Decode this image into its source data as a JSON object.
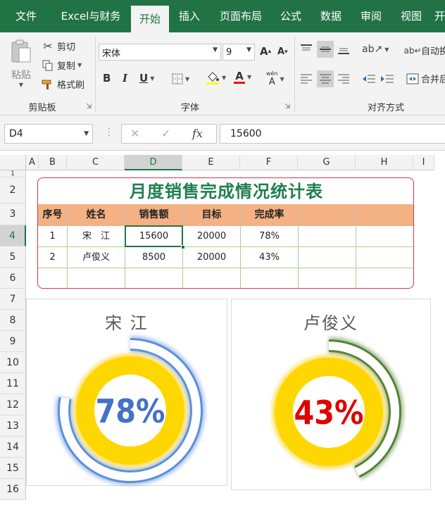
{
  "ribbon": {
    "tabs": [
      "文件",
      "Excel与财务",
      "开始",
      "插入",
      "页面布局",
      "公式",
      "数据",
      "审阅",
      "视图",
      "开"
    ],
    "active_tab": "开始",
    "clipboard": {
      "paste": "粘贴",
      "cut": "剪切",
      "copy": "复制",
      "format_painter": "格式刷",
      "group_label": "剪贴板"
    },
    "font": {
      "font_name": "宋体",
      "font_size": "9",
      "bold": "B",
      "italic": "I",
      "underline": "U",
      "font_color_glyph": "A",
      "phonetic": "wén",
      "grow_glyph": "A",
      "shrink_glyph": "A",
      "group_label": "字体"
    },
    "alignment": {
      "wrap_text": "自动换",
      "merge": "合并后",
      "group_label": "对齐方式"
    }
  },
  "formula_bar": {
    "name_box": "D4",
    "fx": "fx",
    "value": "15600"
  },
  "sheet": {
    "columns": [
      "A",
      "B",
      "C",
      "D",
      "E",
      "F",
      "G",
      "H",
      "I"
    ],
    "selected_column": "D",
    "rows": [
      "1",
      "2",
      "3",
      "4",
      "5",
      "6",
      "7",
      "8",
      "9",
      "10",
      "11",
      "12",
      "13",
      "14",
      "15",
      "16"
    ],
    "selected_row": "4"
  },
  "table": {
    "title": "月度销售完成情况统计表",
    "headers": [
      "序号",
      "姓名",
      "销售额",
      "目标",
      "完成率",
      "",
      ""
    ],
    "rows": [
      [
        "1",
        "宋　江",
        "15600",
        "20000",
        "78%",
        "",
        ""
      ],
      [
        "2",
        "卢俊义",
        "8500",
        "20000",
        "43%",
        "",
        ""
      ],
      [
        "",
        "",
        "",
        "",
        "",
        "",
        ""
      ]
    ]
  },
  "charts": [
    {
      "name": "宋 江",
      "percent_label": "78%",
      "value": 0.78,
      "ring_color": "#5b8fdc",
      "text_color": "#4472c4"
    },
    {
      "name": "卢俊义",
      "percent_label": "43%",
      "value": 0.43,
      "ring_color": "#548235",
      "text_color": "#e00000"
    }
  ],
  "colors": {
    "excel_green": "#217346",
    "header_fill": "#f4b183",
    "title_green": "#1e7e4e",
    "table_border": "#d9344a",
    "donut_yellow": "#ffd700"
  }
}
